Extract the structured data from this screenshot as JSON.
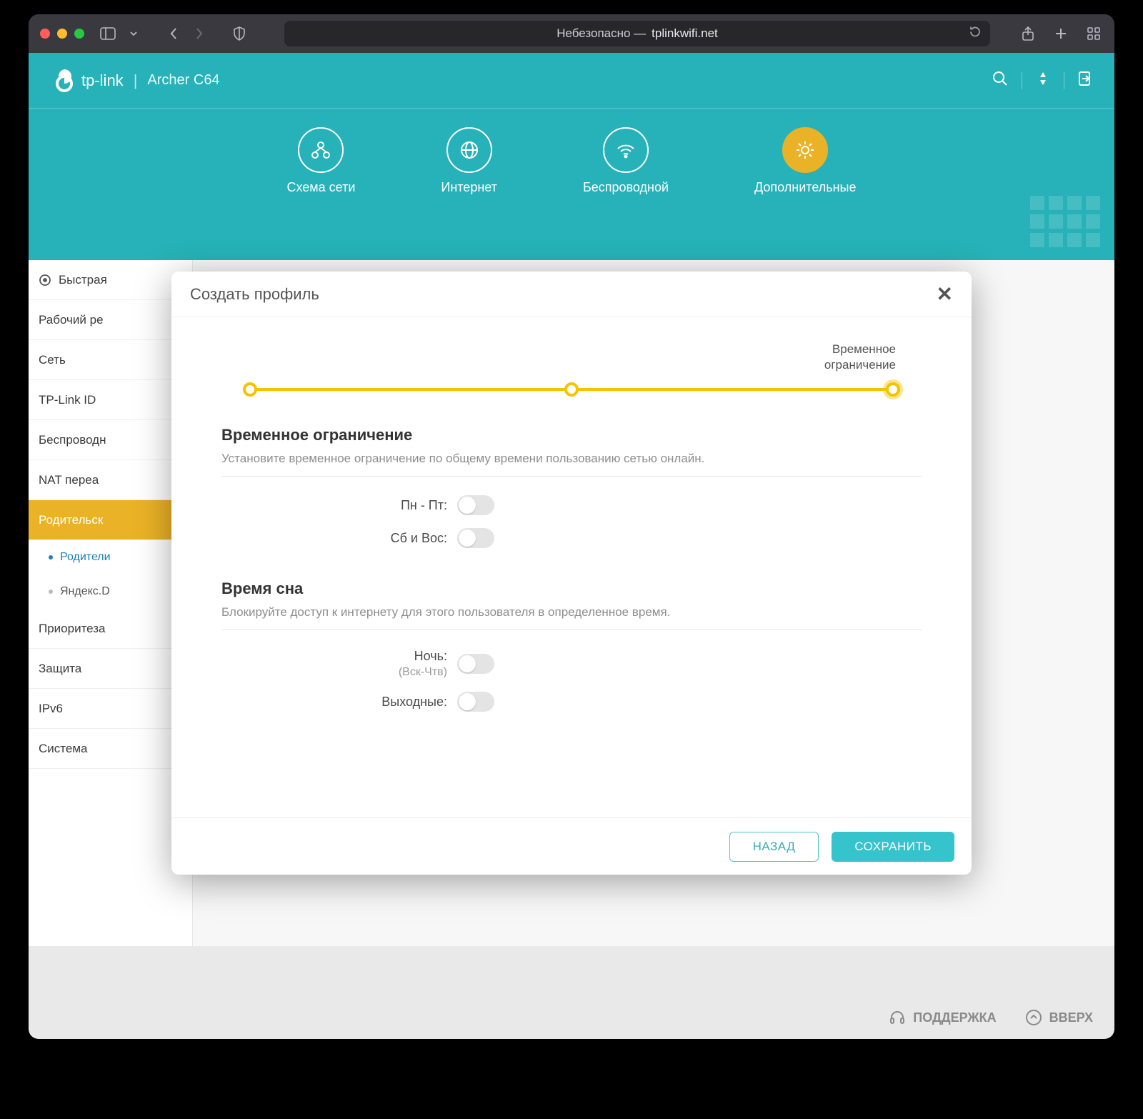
{
  "titlebar": {
    "address_prefix": "Небезопасно —",
    "address_host": "tplinkwifi.net"
  },
  "banner": {
    "brand": "tp-link",
    "model": "Archer C64",
    "nav": [
      {
        "label": "Схема сети"
      },
      {
        "label": "Интернет"
      },
      {
        "label": "Беспроводной"
      },
      {
        "label": "Дополнительные"
      }
    ]
  },
  "sidebar": {
    "items": [
      "Быстрая",
      "Рабочий ре",
      "Сеть",
      "TP-Link ID",
      "Беспроводн",
      "NAT переа",
      "Родительск",
      "Приоритеза",
      "Защита",
      "IPv6",
      "Система"
    ],
    "subitems": [
      "Родители",
      "Яндекс.D"
    ]
  },
  "footer": {
    "support": "ПОДДЕРЖКА",
    "up": "ВВЕРХ"
  },
  "modal": {
    "title": "Создать профиль",
    "step_caption_line1": "Временное",
    "step_caption_line2": "ограничение",
    "section1_title": "Временное ограничение",
    "section1_desc": "Установите временное ограничение по общему времени пользованию сетью онлайн.",
    "row_weekdays": "Пн - Пт:",
    "row_weekend": "Сб и Вос:",
    "section2_title": "Время сна",
    "section2_desc": "Блокируйте доступ к интернету для этого пользователя в определенное время.",
    "row_night": "Ночь:",
    "row_night_sub": "(Вск-Чтв)",
    "row_wknd": "Выходные:",
    "btn_back": "НАЗАД",
    "btn_save": "СОХРАНИТЬ"
  }
}
